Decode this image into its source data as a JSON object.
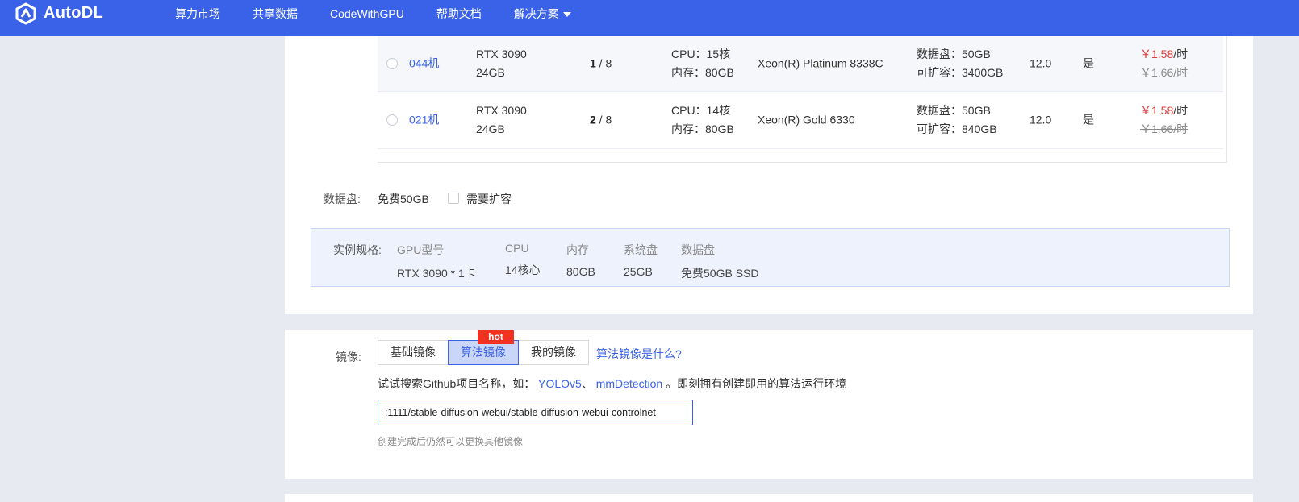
{
  "header": {
    "logo_text": "AutoDL",
    "logo_icon": "autodl-logo-icon",
    "nav": [
      "算力市场",
      "共享数据",
      "CodeWithGPU",
      "帮助文档",
      "解决方案"
    ]
  },
  "table": {
    "rows": [
      {
        "selected": false,
        "machine": "044机",
        "gpu_model": "RTX 3090",
        "gpu_mem": "24GB",
        "free_gpus": "1",
        "total_gpus": " / 8",
        "cpu": "CPU：15核",
        "mem": "内存：80GB",
        "cpu_name": "Xeon(R) Platinum 8338C",
        "data_disk": "数据盘：50GB",
        "expandable": "可扩容：3400GB",
        "cuda": "12.0",
        "yes": "是",
        "price": "￥1.58",
        "price_unit": "/时",
        "old_price": "￥1.66/时"
      },
      {
        "selected": false,
        "machine": "021机",
        "gpu_model": "RTX 3090",
        "gpu_mem": "24GB",
        "free_gpus": "2",
        "total_gpus": " / 8",
        "cpu": "CPU：14核",
        "mem": "内存：80GB",
        "cpu_name": "Xeon(R) Gold 6330",
        "data_disk": "数据盘：50GB",
        "expandable": "可扩容：840GB",
        "cuda": "12.0",
        "yes": "是",
        "price": "￥1.58",
        "price_unit": "/时",
        "old_price": "￥1.66/时"
      }
    ]
  },
  "data_disk": {
    "label": "数据盘:",
    "free": "免费50GB",
    "expand_label": "需要扩容",
    "expand_checked": false
  },
  "spec": {
    "label": "实例规格:",
    "columns": [
      {
        "header": "GPU型号",
        "value": "RTX 3090 * 1卡"
      },
      {
        "header": "CPU",
        "value": "14核心"
      },
      {
        "header": "内存",
        "value": "80GB"
      },
      {
        "header": "系统盘",
        "value": "25GB"
      },
      {
        "header": "数据盘",
        "value": "免费50GB SSD"
      }
    ]
  },
  "image": {
    "label": "镜像:",
    "tabs": [
      "基础镜像",
      "算法镜像",
      "我的镜像"
    ],
    "active_tab": "算法镜像",
    "hot_badge": "hot",
    "what_link": "算法镜像是什么?",
    "hint_prefix": "试试搜索Github项目名称，如：",
    "hint_link1": "YOLOv5",
    "hint_sep": "、",
    "hint_link2": "mmDetection",
    "hint_suffix": " 。即刻拥有创建即用的算法运行环境",
    "search_value": ":1111/stable-diffusion-webui/stable-diffusion-webui-controlnet",
    "note": "创建完成后仍然可以更换其他镜像"
  },
  "colors": {
    "brand": "#3a62e8",
    "price": "#e23b3b",
    "hot": "#f0321e"
  }
}
